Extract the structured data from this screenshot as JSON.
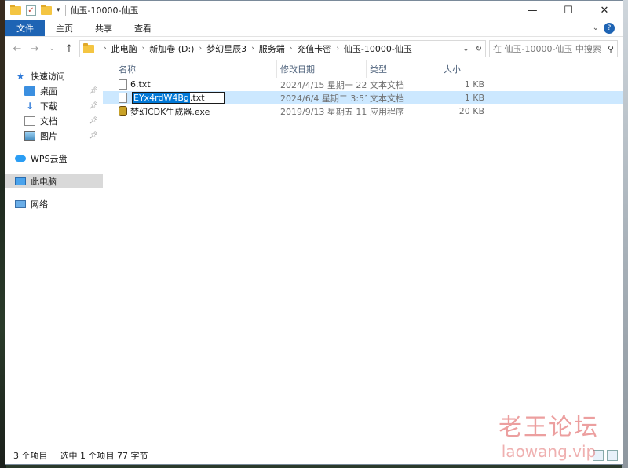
{
  "window": {
    "title": "仙玉-10000-仙玉"
  },
  "titlebar": {
    "minimize": "—",
    "maximize": "☐",
    "close": "✕"
  },
  "ribbon": {
    "tabs": [
      "文件",
      "主页",
      "共享",
      "查看"
    ]
  },
  "address": {
    "crumbs": [
      "此电脑",
      "新加卷 (D:)",
      "梦幻星辰3",
      "服务端",
      "充值卡密",
      "仙玉-10000-仙玉"
    ],
    "search_placeholder": "在 仙玉-10000-仙玉 中搜索"
  },
  "nav": {
    "quick_access": "快速访问",
    "desktop": "桌面",
    "downloads": "下载",
    "documents": "文档",
    "pictures": "图片",
    "wps": "WPS云盘",
    "this_pc": "此电脑",
    "network": "网络"
  },
  "columns": {
    "name": "名称",
    "date": "修改日期",
    "type": "类型",
    "size": "大小"
  },
  "files": [
    {
      "name": "6.txt",
      "date": "2024/4/15 星期一 22:...",
      "type": "文本文档",
      "size": "1 KB"
    },
    {
      "name_selected": "EYx4rdW4Bg",
      "name_ext": ".txt",
      "date": "2024/6/4 星期二 3:51",
      "type": "文本文档",
      "size": "1 KB"
    },
    {
      "name": "梦幻CDK生成器.exe",
      "date": "2019/9/13 星期五 11:...",
      "type": "应用程序",
      "size": "20 KB"
    }
  ],
  "status": {
    "count": "3 个项目",
    "selected": "选中 1 个项目  77 字节"
  },
  "watermark": {
    "cn": "老王论坛",
    "en": "laowang.vip"
  }
}
